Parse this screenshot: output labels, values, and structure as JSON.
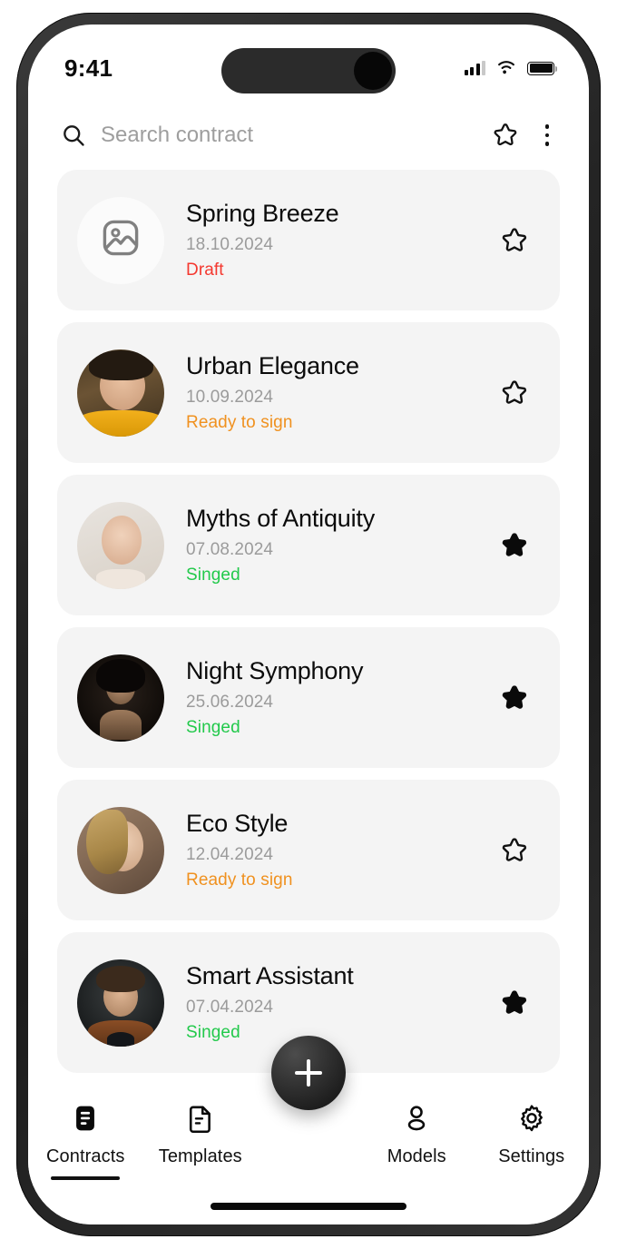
{
  "status_bar": {
    "time": "9:41",
    "signal_icon": "cellular-signal-icon",
    "wifi_icon": "wifi-icon",
    "battery_icon": "battery-full-icon"
  },
  "search": {
    "placeholder": "Search contract",
    "value": "",
    "search_icon": "search-icon",
    "favorites_icon": "star-outline-icon",
    "overflow_icon": "more-vertical-icon"
  },
  "colors": {
    "status_draft": "#f4382f",
    "status_ready": "#f0911f",
    "status_signed": "#22c94b",
    "card_bg": "#f4f4f4",
    "date_text": "#9b9b9b",
    "title_text": "#0b0b0b"
  },
  "contracts": [
    {
      "title": "Spring Breeze",
      "date": "18.10.2024",
      "status": "Draft",
      "status_color": "#f4382f",
      "favorite": false,
      "thumb": "image-placeholder-icon"
    },
    {
      "title": "Urban Elegance",
      "date": "10.09.2024",
      "status": "Ready to sign",
      "status_color": "#f0911f",
      "favorite": false,
      "thumb": "avatar-photo"
    },
    {
      "title": "Myths of Antiquity",
      "date": "07.08.2024",
      "status": "Singed",
      "status_color": "#22c94b",
      "favorite": true,
      "thumb": "avatar-photo"
    },
    {
      "title": "Night Symphony",
      "date": "25.06.2024",
      "status": "Singed",
      "status_color": "#22c94b",
      "favorite": true,
      "thumb": "avatar-photo"
    },
    {
      "title": "Eco Style",
      "date": "12.04.2024",
      "status": "Ready to sign",
      "status_color": "#f0911f",
      "favorite": false,
      "thumb": "avatar-photo"
    },
    {
      "title": "Smart Assistant",
      "date": "07.04.2024",
      "status": "Singed",
      "status_color": "#22c94b",
      "favorite": true,
      "thumb": "avatar-photo"
    }
  ],
  "fab": {
    "label": "+",
    "icon": "plus-icon"
  },
  "bottom_nav": {
    "items": [
      {
        "label": "Contracts",
        "icon": "contracts-document-icon",
        "active": true
      },
      {
        "label": "Templates",
        "icon": "template-file-icon",
        "active": false
      },
      {
        "label": "Models",
        "icon": "person-icon",
        "active": false
      },
      {
        "label": "Settings",
        "icon": "gear-icon",
        "active": false
      }
    ]
  }
}
